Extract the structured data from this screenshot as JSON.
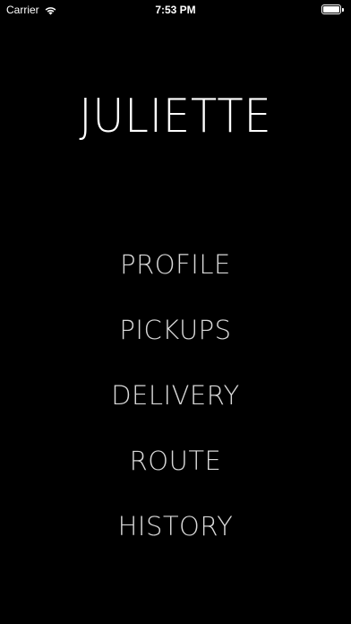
{
  "status_bar": {
    "carrier": "Carrier",
    "time": "7:53 PM",
    "battery_level": 1.0
  },
  "app_title": "JULIETTE",
  "menu": {
    "items": [
      {
        "label": "PROFILE"
      },
      {
        "label": "PICKUPS"
      },
      {
        "label": "DELIVERY"
      },
      {
        "label": "ROUTE"
      },
      {
        "label": "HISTORY"
      }
    ]
  },
  "colors": {
    "background": "#000000",
    "title": "#ffffff",
    "menu_text": "#d8d8d8"
  }
}
